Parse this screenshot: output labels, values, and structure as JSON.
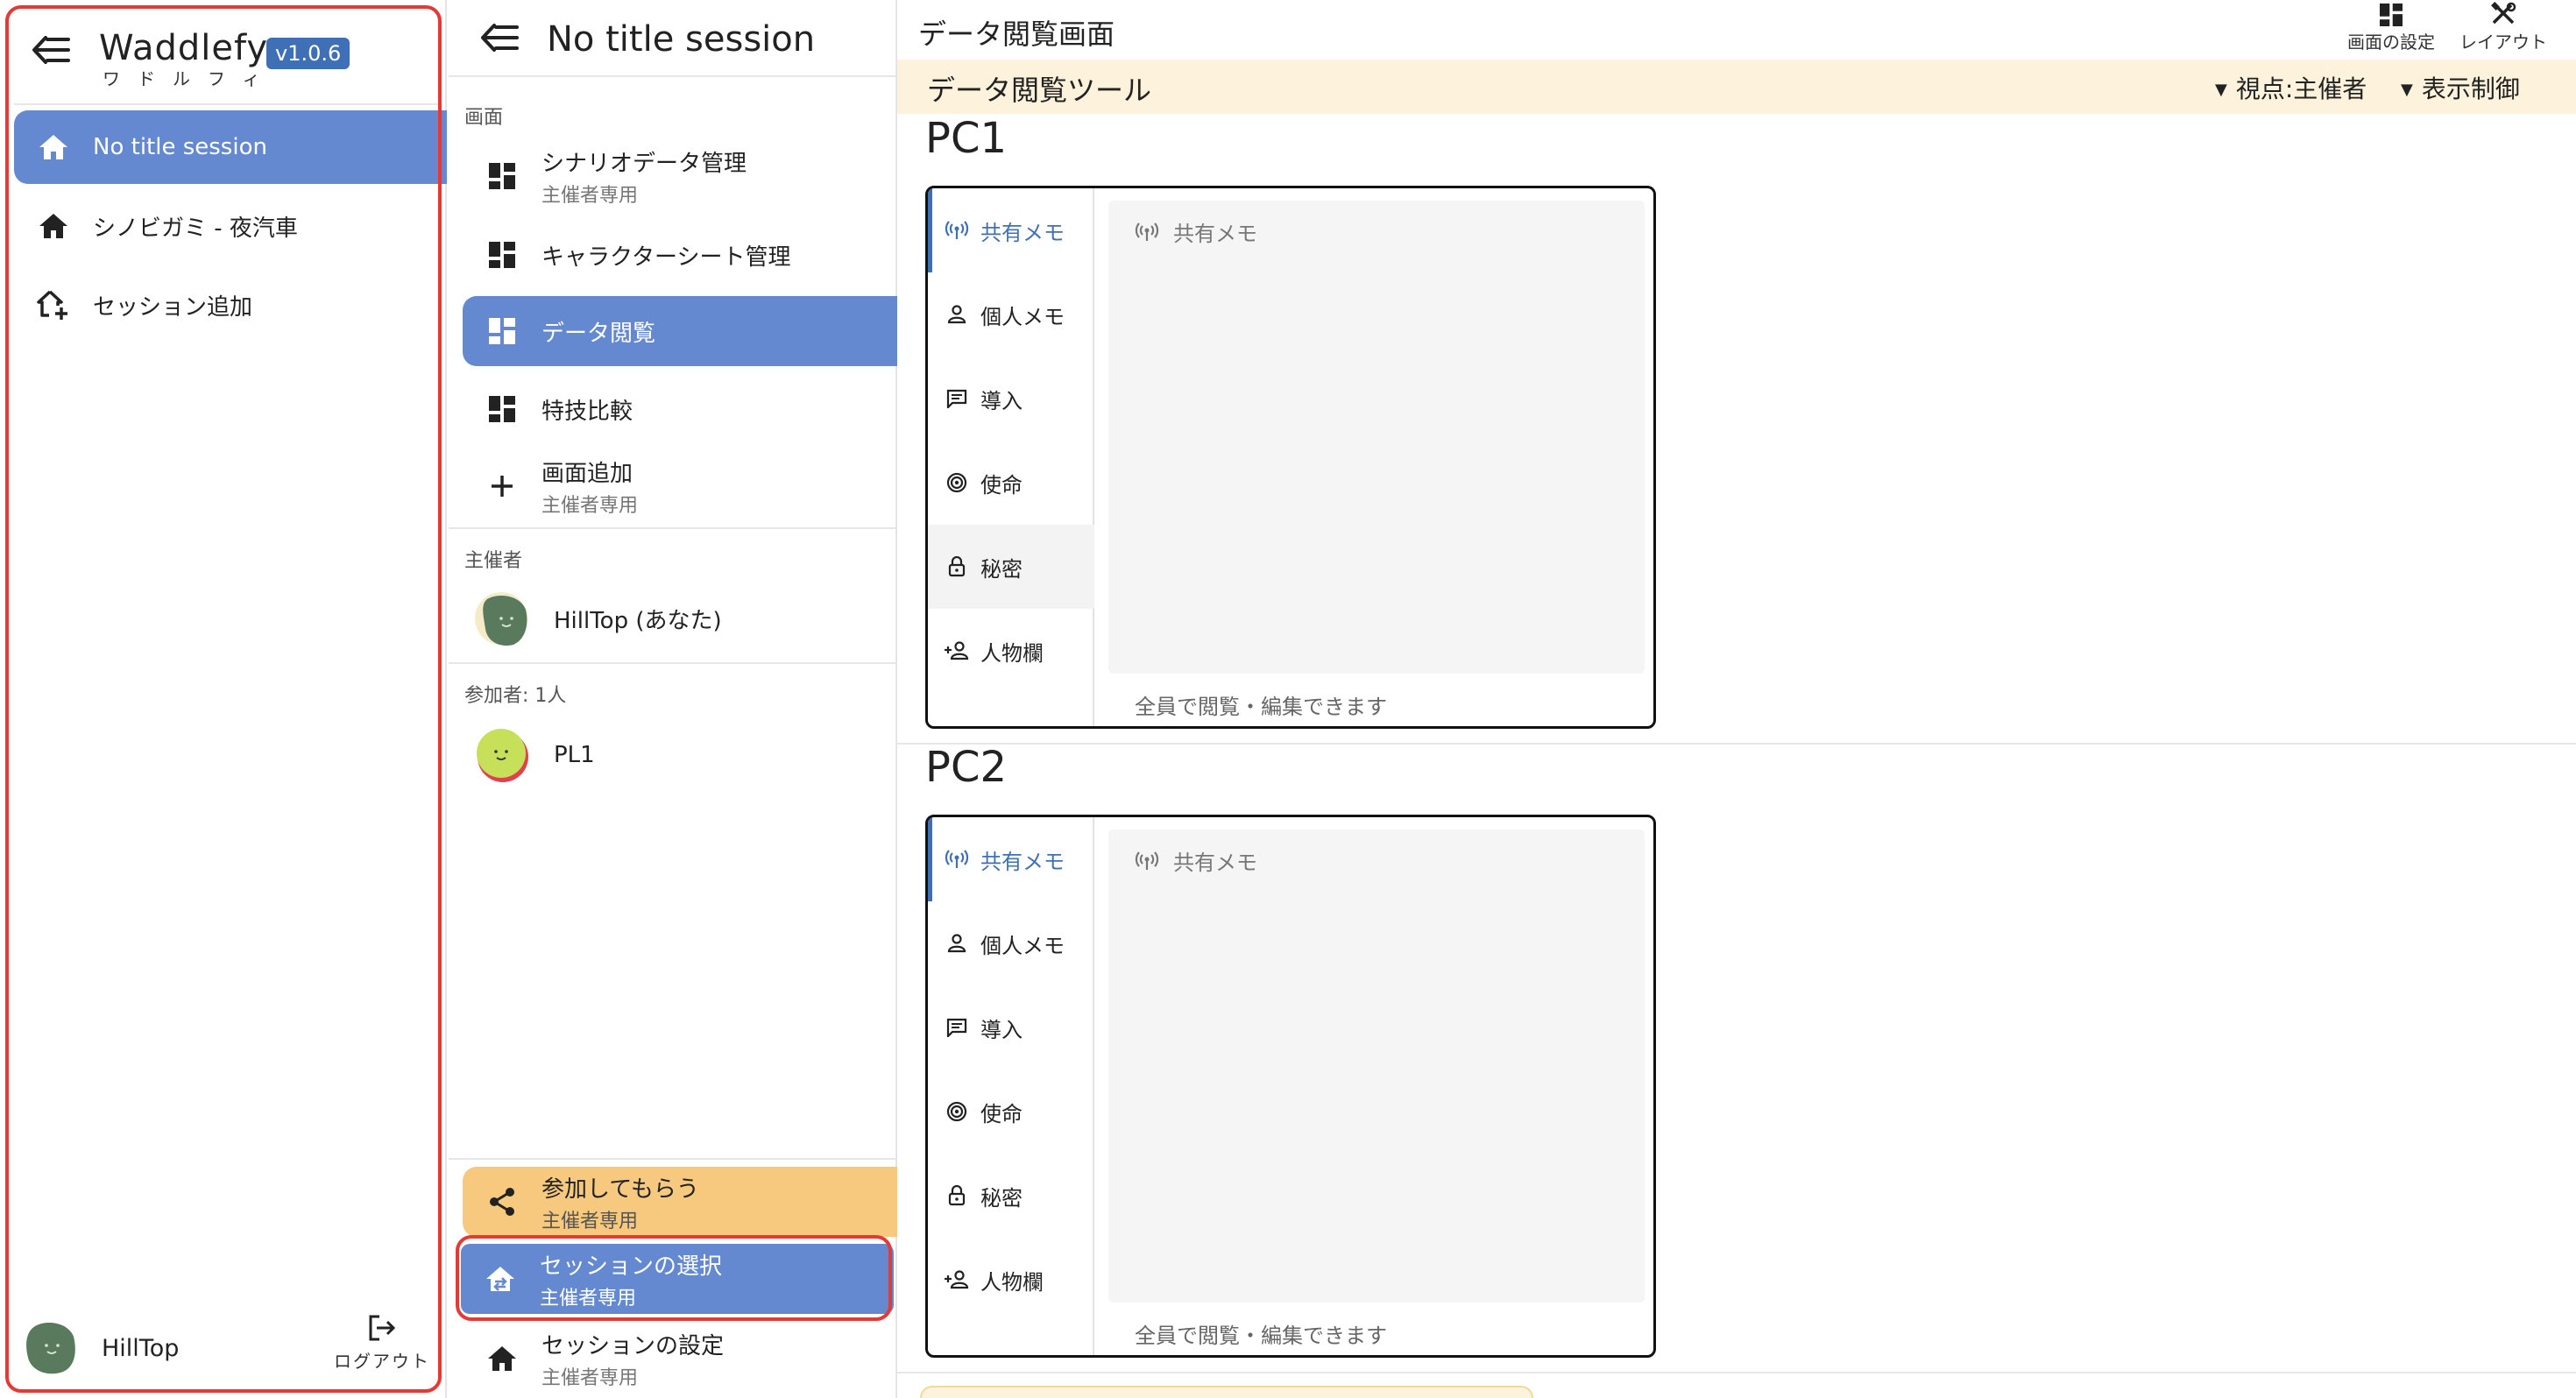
{
  "left_sidebar": {
    "app_name": "Waddlefy",
    "app_kana": "ワドルフィ",
    "version": "v1.0.6",
    "sessions": [
      {
        "label": "No title session",
        "icon": "home-icon",
        "active": true
      },
      {
        "label": "シノビガミ - 夜汽車",
        "icon": "home-icon",
        "active": false
      }
    ],
    "add_session_label": "セッション追加",
    "user_name": "HillTop",
    "logout_label": "ログアウト"
  },
  "session_sidebar": {
    "title": "No title session",
    "screens_label": "画面",
    "screens": [
      {
        "label": "シナリオデータ管理",
        "sub": "主催者専用"
      },
      {
        "label": "キャラクターシート管理",
        "sub": ""
      },
      {
        "label": "データ閲覧",
        "sub": "",
        "active": true
      },
      {
        "label": "特技比較",
        "sub": ""
      }
    ],
    "add_screen": {
      "label": "画面追加",
      "sub": "主催者専用"
    },
    "host_label": "主催者",
    "host_name": "HillTop (あなた)",
    "participants_label": "参加者: 1人",
    "participant_name": "PL1",
    "invite": {
      "label": "参加してもらう",
      "sub": "主催者専用"
    },
    "select_session": {
      "label": "セッションの選択",
      "sub": "主催者専用"
    },
    "session_settings": {
      "label": "セッションの設定",
      "sub": "主催者専用"
    }
  },
  "main": {
    "title": "データ閲覧画面",
    "screen_settings_label": "画面の設定",
    "layout_label": "レイアウト",
    "tool_title": "データ閲覧ツール",
    "viewpoint_label": "視点:主催者",
    "display_control_label": "表示制御",
    "tabs": [
      "共有メモ",
      "個人メモ",
      "導入",
      "使命",
      "秘密",
      "人物欄"
    ],
    "pcs": [
      {
        "name": "PC1",
        "placeholder": "共有メモ",
        "help": "全員で閲覧・編集できます"
      },
      {
        "name": "PC2",
        "placeholder": "共有メモ",
        "help": "全員で閲覧・編集できます"
      }
    ]
  },
  "colors": {
    "accent_blue": "#6489d1",
    "version_badge": "#3f6fb5",
    "highlight_red": "#e53935",
    "toolbar_yellow": "#fdf3dc",
    "invite_orange": "#f7c97e"
  }
}
